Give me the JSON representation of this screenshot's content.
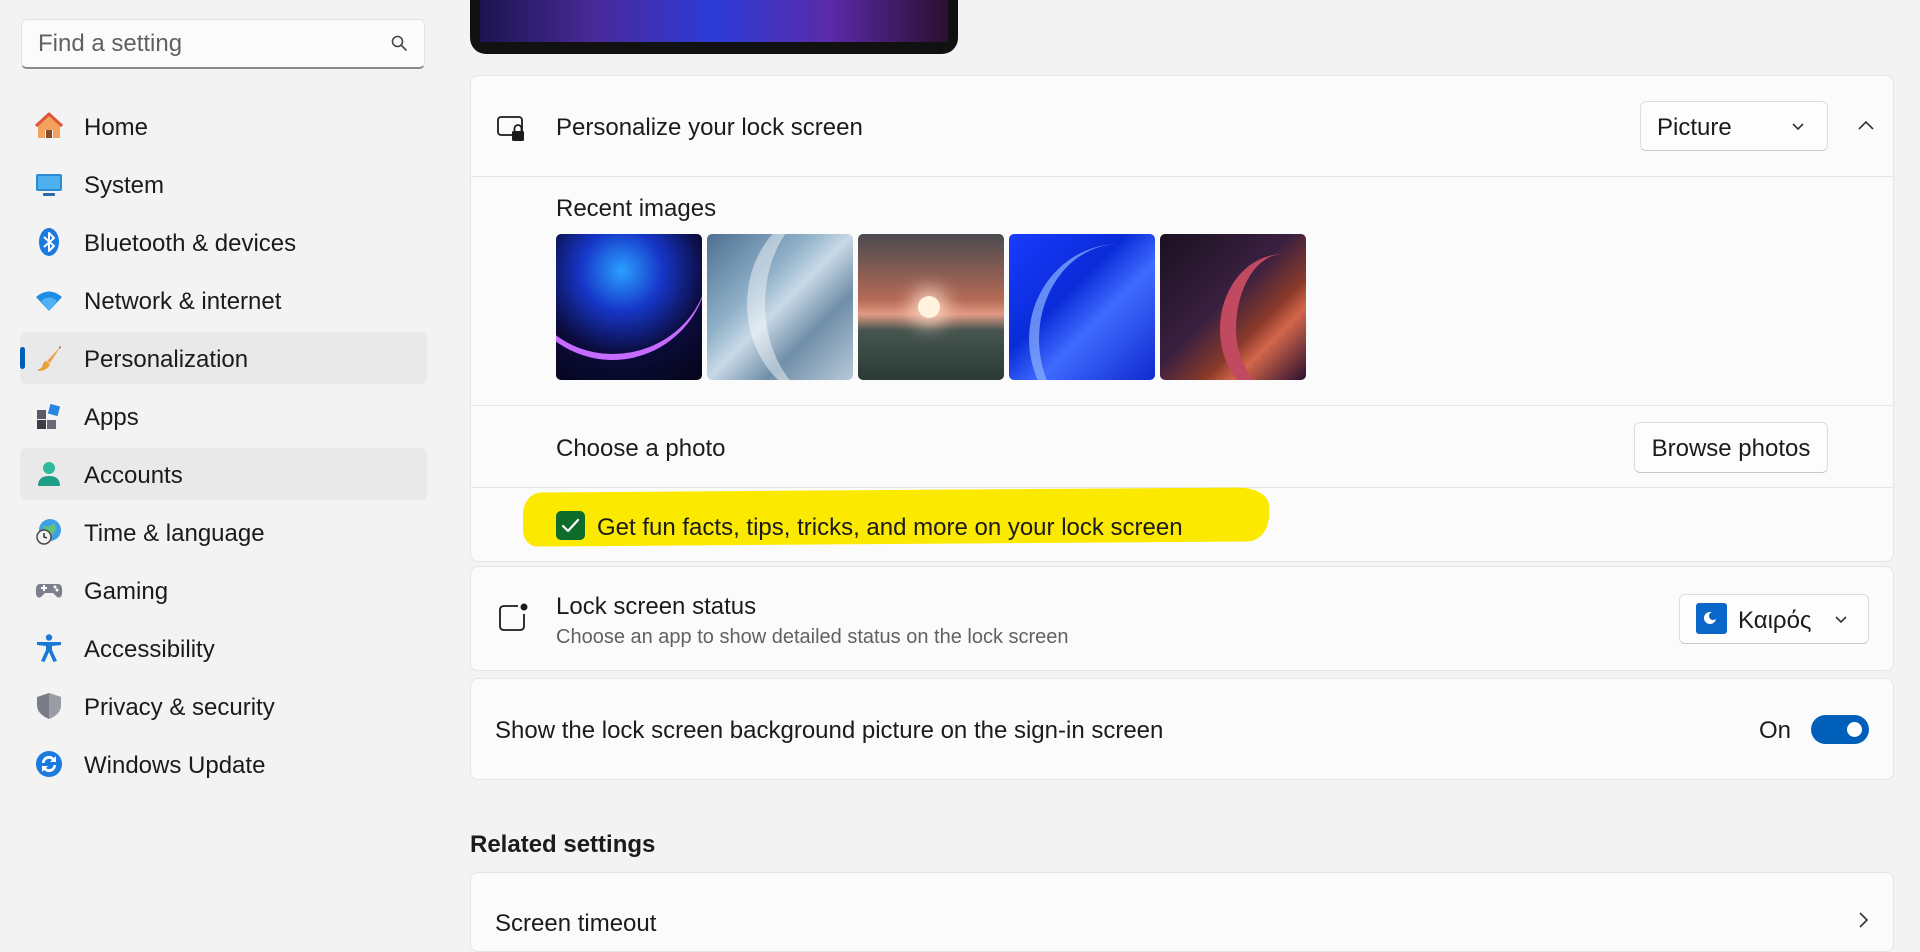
{
  "search": {
    "placeholder": "Find a setting"
  },
  "nav": {
    "items": [
      {
        "label": "Home"
      },
      {
        "label": "System"
      },
      {
        "label": "Bluetooth & devices"
      },
      {
        "label": "Network & internet"
      },
      {
        "label": "Personalization"
      },
      {
        "label": "Apps"
      },
      {
        "label": "Accounts"
      },
      {
        "label": "Time & language"
      },
      {
        "label": "Gaming"
      },
      {
        "label": "Accessibility"
      },
      {
        "label": "Privacy & security"
      },
      {
        "label": "Windows Update"
      }
    ],
    "selected": "Personalization",
    "accent_color": "#005fb8"
  },
  "lock_screen": {
    "personalize_label": "Personalize your lock screen",
    "mode_value": "Picture",
    "recent_images_label": "Recent images",
    "choose_photo_label": "Choose a photo",
    "browse_label": "Browse photos",
    "fun_facts_label": "Get fun facts, tips, tricks, and more on your lock screen",
    "fun_facts_checked": true,
    "highlight_color": "#fbe900"
  },
  "status": {
    "title": "Lock screen status",
    "subtitle": "Choose an app to show detailed status on the lock screen",
    "app_value": "Καιρός"
  },
  "signin": {
    "label": "Show the lock screen background picture on the sign-in screen",
    "state_label": "On",
    "enabled": true
  },
  "related": {
    "title": "Related settings",
    "screen_timeout_label": "Screen timeout"
  }
}
